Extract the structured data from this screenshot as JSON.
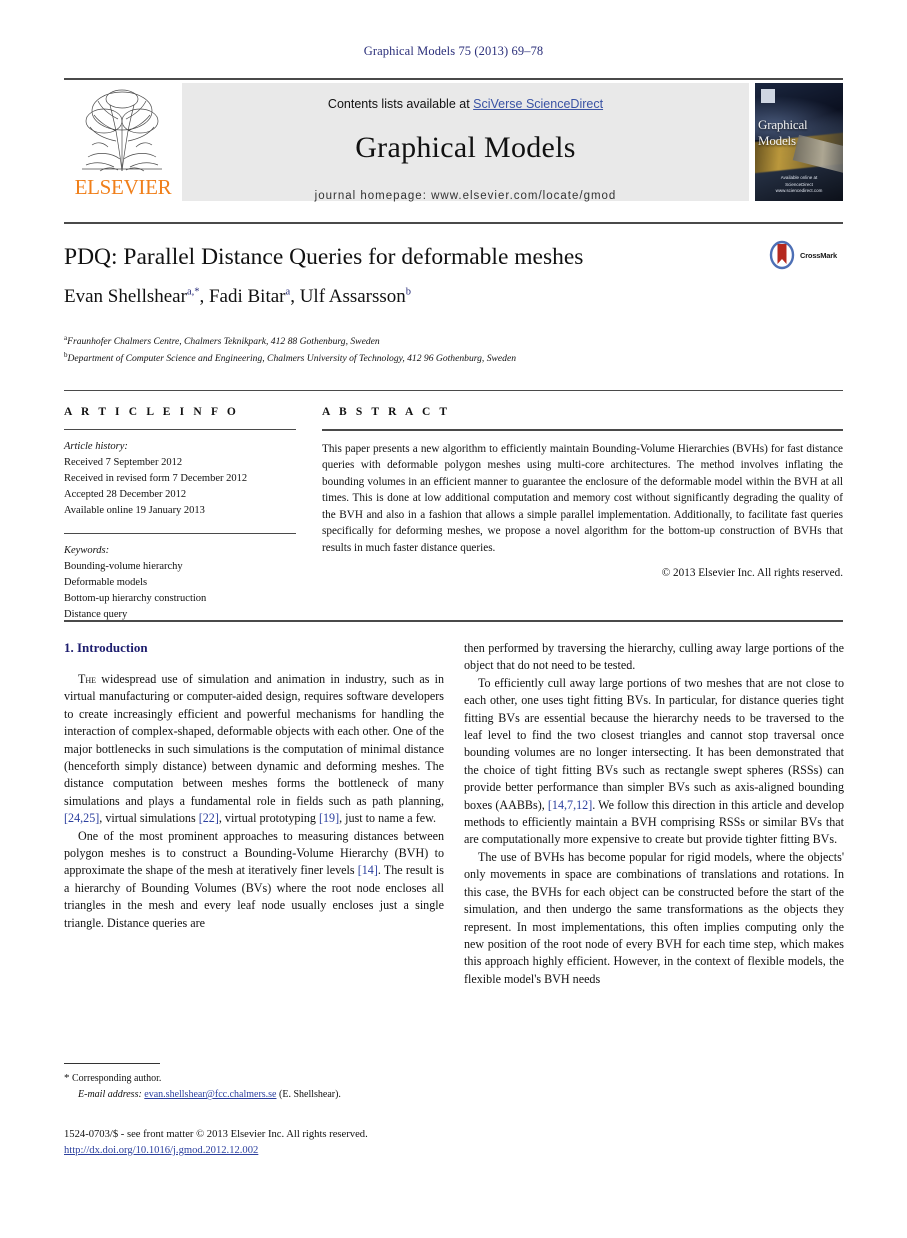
{
  "running_head": "Graphical Models 75 (2013) 69–78",
  "banner": {
    "contents_prefix": "Contents lists available at ",
    "sciencedirect_link": "SciVerse ScienceDirect",
    "journal_title": "Graphical Models",
    "homepage": "journal homepage: www.elsevier.com/locate/gmod",
    "publisher_name": "ELSEVIER",
    "cover": {
      "title": "Graphical Models",
      "footer_line1": "Available online at",
      "footer_line2": "ScienceDirect",
      "footer_line3": "www.sciencedirect.com"
    }
  },
  "article": {
    "title": "PDQ: Parallel Distance Queries for deformable meshes",
    "crossmark_label": "CrossMark",
    "authors_html": "Evan Shellshear<sup>a,*</sup>, Fadi Bitar<sup>a</sup>, Ulf Assarsson<sup>b</sup>",
    "affiliation_a_marker": "a",
    "affiliation_a": "Fraunhofer Chalmers Centre, Chalmers Teknikpark, 412 88 Gothenburg, Sweden",
    "affiliation_b_marker": "b",
    "affiliation_b": "Department of Computer Science and Engineering, Chalmers University of Technology, 412 96 Gothenburg, Sweden"
  },
  "article_info": {
    "heading": "A R T I C L E   I N F O",
    "history_label": "Article history:",
    "history": [
      "Received 7 September 2012",
      "Received in revised form 7 December 2012",
      "Accepted 28 December 2012",
      "Available online 19 January 2013"
    ],
    "keywords_label": "Keywords:",
    "keywords": [
      "Bounding-volume hierarchy",
      "Deformable models",
      "Bottom-up hierarchy construction",
      "Distance query"
    ]
  },
  "abstract": {
    "heading": "A B S T R A C T",
    "text": "This paper presents a new algorithm to efficiently maintain Bounding-Volume Hierarchies (BVHs) for fast distance queries with deformable polygon meshes using multi-core architectures. The method involves inflating the bounding volumes in an efficient manner to guarantee the enclosure of the deformable model within the BVH at all times. This is done at low additional computation and memory cost without significantly degrading the quality of the BVH and also in a fashion that allows a simple parallel implementation. Additionally, to facilitate fast queries specifically for deforming meshes, we propose a novel algorithm for the bottom-up construction of BVHs that results in much faster distance queries.",
    "rights": "© 2013 Elsevier Inc. All rights reserved."
  },
  "body": {
    "section_heading": "1. Introduction",
    "left_paragraphs": [
      "THE widespread use of simulation and animation in industry, such as in virtual manufacturing or computer-aided design, requires software developers to create increasingly efficient and powerful mechanisms for handling the interaction of complex-shaped, deformable objects with each other. One of the major bottlenecks in such simulations is the computation of minimal distance (henceforth simply distance) between dynamic and deforming meshes. The distance computation between meshes forms the bottleneck of many simulations and plays a fundamental role in fields such as path planning, [24,25], virtual simulations [22], virtual prototyping [19], just to name a few.",
      "One of the most prominent approaches to measuring distances between polygon meshes is to construct a Bounding-Volume Hierarchy (BVH) to approximate the shape of the mesh at iteratively finer levels [14]. The result is a hierarchy of Bounding Volumes (BVs) where the root node encloses all triangles in the mesh and every leaf node usually encloses just a single triangle. Distance queries are"
    ],
    "right_paragraphs": [
      "then performed by traversing the hierarchy, culling away large portions of the object that do not need to be tested.",
      "To efficiently cull away large portions of two meshes that are not close to each other, one uses tight fitting BVs. In particular, for distance queries tight fitting BVs are essential because the hierarchy needs to be traversed to the leaf level to find the two closest triangles and cannot stop traversal once bounding volumes are no longer intersecting. It has been demonstrated that the choice of tight fitting BVs such as rectangle swept spheres (RSSs) can provide better performance than simpler BVs such as axis-aligned bounding boxes (AABBs), [14,7,12]. We follow this direction in this article and develop methods to efficiently maintain a BVH comprising RSSs or similar BVs that are computationally more expensive to create but provide tighter fitting BVs.",
      "The use of BVHs has become popular for rigid models, where the objects' only movements in space are combinations of translations and rotations. In this case, the BVHs for each object can be constructed before the start of the simulation, and then undergo the same transformations as the objects they represent. In most implementations, this often implies computing only the new position of the root node of every BVH for each time step, which makes this approach highly efficient. However, in the context of flexible models, the flexible model's BVH needs"
    ]
  },
  "footnotes": {
    "corresponding_marker": "*",
    "corresponding_author": "Corresponding author.",
    "email_label": "E-mail address:",
    "email": "evan.shellshear@fcc.chalmers.se",
    "email_owner": "(E. Shellshear)."
  },
  "publication": {
    "issn_line": "1524-0703/$ - see front matter © 2013 Elsevier Inc. All rights reserved.",
    "doi": "http://dx.doi.org/10.1016/j.gmod.2012.12.002"
  },
  "colors": {
    "link_blue": "#2b3f9e",
    "heading_blue": "#1d1d6e",
    "elsevier_orange": "#f07f1a",
    "banner_gray": "#e9e9e9"
  }
}
